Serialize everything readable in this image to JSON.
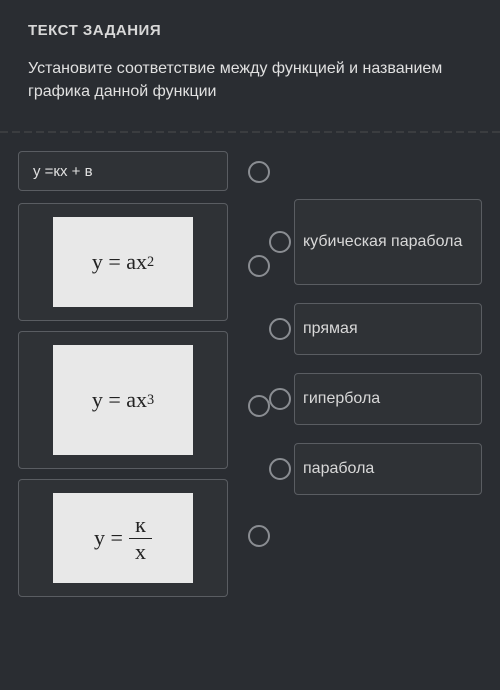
{
  "header": {
    "title": "ТЕКСТ ЗАДАНИЯ",
    "instruction": "Установите соответствие между функцией и названием графика данной функции"
  },
  "left_items": [
    {
      "type": "text",
      "content": "y =кx + в"
    },
    {
      "type": "formula",
      "base": "y = ax",
      "sup": "2"
    },
    {
      "type": "formula",
      "base": "y = ax",
      "sup": "3"
    },
    {
      "type": "fraction",
      "prefix": "y = ",
      "num": "к",
      "den": "x"
    }
  ],
  "right_items": [
    "кубическая парабола",
    "прямая",
    "гипербола",
    "парабола"
  ]
}
